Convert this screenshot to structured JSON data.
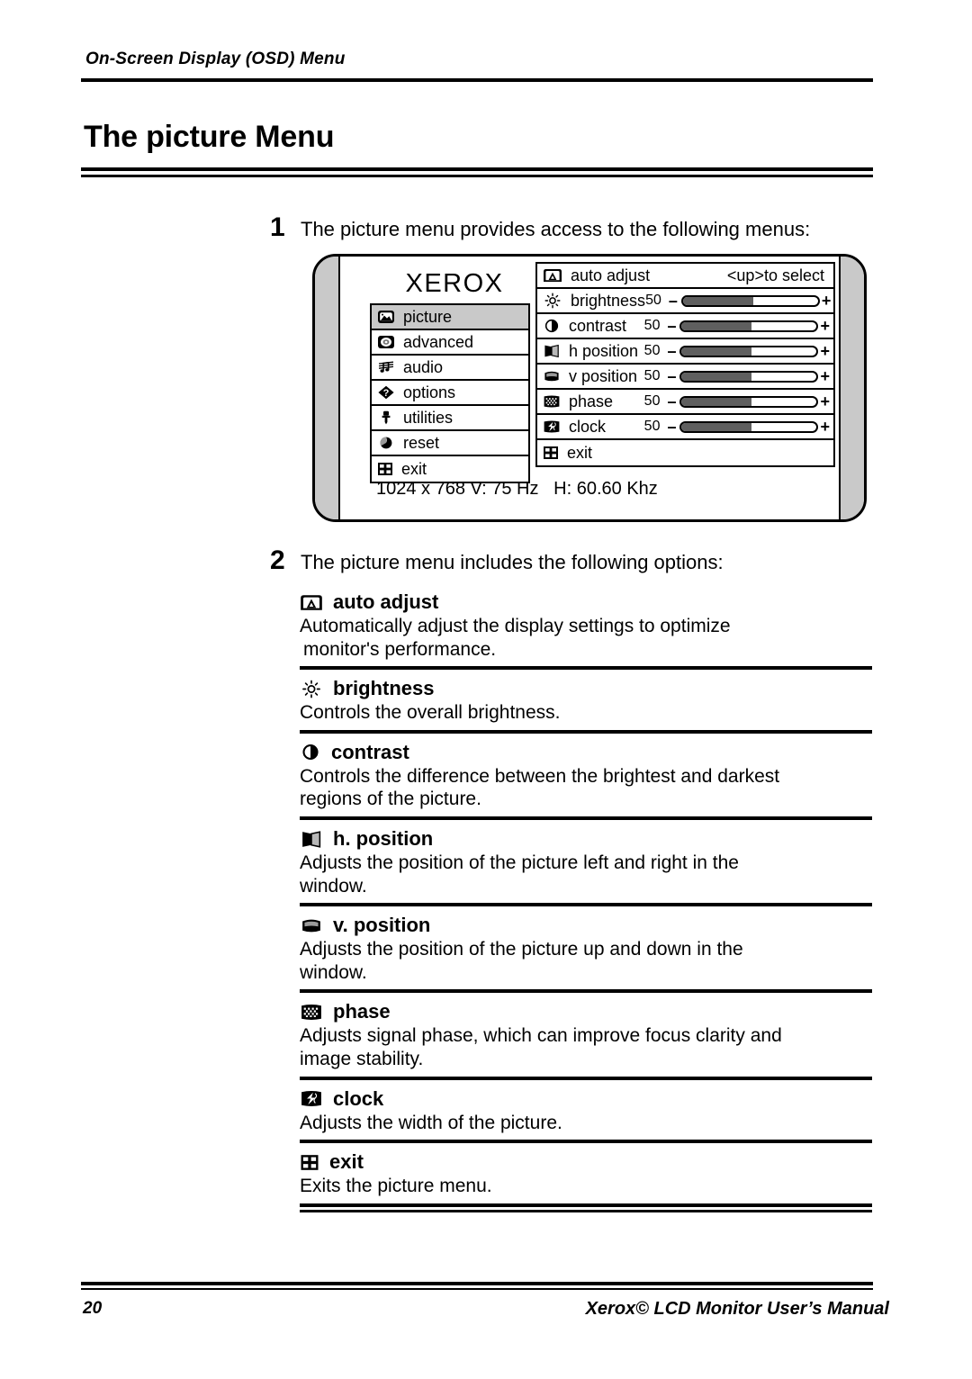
{
  "running_head": "On-Screen Display (OSD) Menu",
  "page_title": "The picture Menu",
  "steps": [
    {
      "num": "1",
      "text": "The picture menu provides access to the following menus:"
    },
    {
      "num": "2",
      "text": "The picture menu includes the following options:"
    }
  ],
  "osd": {
    "logo": "XEROX",
    "status_line": "1024 x 768 V: 75 Hz   H: 60.60 Khz",
    "sidebar": [
      {
        "icon": "picture-icon",
        "label": "picture",
        "selected": true
      },
      {
        "icon": "advanced-icon",
        "label": "advanced",
        "selected": false
      },
      {
        "icon": "audio-icon",
        "label": "audio",
        "selected": false
      },
      {
        "icon": "options-icon",
        "label": "options",
        "selected": false
      },
      {
        "icon": "utilities-icon",
        "label": "utilities",
        "selected": false
      },
      {
        "icon": "reset-icon",
        "label": "reset",
        "selected": false
      },
      {
        "icon": "exit-icon",
        "label": "exit",
        "selected": false
      }
    ],
    "items": [
      {
        "icon": "auto-adjust-icon",
        "label": "auto adjust",
        "hint": "<up>to select",
        "slider": false
      },
      {
        "icon": "brightness-icon",
        "label": "brightness",
        "value": "50",
        "minus": "–",
        "plus": "+",
        "slider": true,
        "fill_pct": 52
      },
      {
        "icon": "contrast-icon",
        "label": "contrast",
        "value": "50",
        "minus": "–",
        "plus": "+",
        "slider": true,
        "fill_pct": 52
      },
      {
        "icon": "h-position-icon",
        "label": "h position",
        "value": "50",
        "minus": "–",
        "plus": "+",
        "slider": true,
        "fill_pct": 52
      },
      {
        "icon": "v-position-icon",
        "label": "v position",
        "value": "50",
        "minus": "–",
        "plus": "+",
        "slider": true,
        "fill_pct": 52
      },
      {
        "icon": "phase-icon",
        "label": "phase",
        "value": "50",
        "minus": "–",
        "plus": "+",
        "slider": true,
        "fill_pct": 52
      },
      {
        "icon": "clock-icon",
        "label": "clock",
        "value": "50",
        "minus": "–",
        "plus": "+",
        "slider": true,
        "fill_pct": 52
      },
      {
        "icon": "exit-icon",
        "label": "exit",
        "slider": false
      }
    ]
  },
  "sections": [
    {
      "icon": "auto-adjust-icon",
      "heading": "auto adjust",
      "line1": "Automatically adjust the display settings to optimize",
      "line2": "monitor's performance."
    },
    {
      "icon": "brightness-icon",
      "heading": "brightness",
      "line1": "Controls the overall brightness.",
      "line2": ""
    },
    {
      "icon": "contrast-icon",
      "heading": "contrast",
      "line1": "Controls the difference between the brightest and darkest",
      "line2": "regions of the picture."
    },
    {
      "icon": "h-position-icon",
      "heading": "h. position",
      "line1": "Adjusts  the position of the picture left and right in the",
      "line2": "window."
    },
    {
      "icon": "v-position-icon",
      "heading": "v. position",
      "line1": "Adjusts the position of the picture up and down in the",
      "line2": "window."
    },
    {
      "icon": "phase-icon",
      "heading": "phase",
      "line1": "Adjusts signal phase, which can improve focus clarity and",
      "line2": "image stability."
    },
    {
      "icon": "clock-icon",
      "heading": "clock",
      "line1": "Adjusts the width of the picture.",
      "line2": ""
    },
    {
      "icon": "exit-icon",
      "heading": "exit",
      "line1": "Exits the picture menu.",
      "line2": ""
    }
  ],
  "footer": {
    "page_number": "20",
    "manual_title": "Xerox© LCD Monitor User’s Manual"
  },
  "colors": {
    "ink": "#000000",
    "highlight": "#c9c9c9",
    "slider_fill": "#5f5f5f",
    "paper": "#ffffff"
  }
}
